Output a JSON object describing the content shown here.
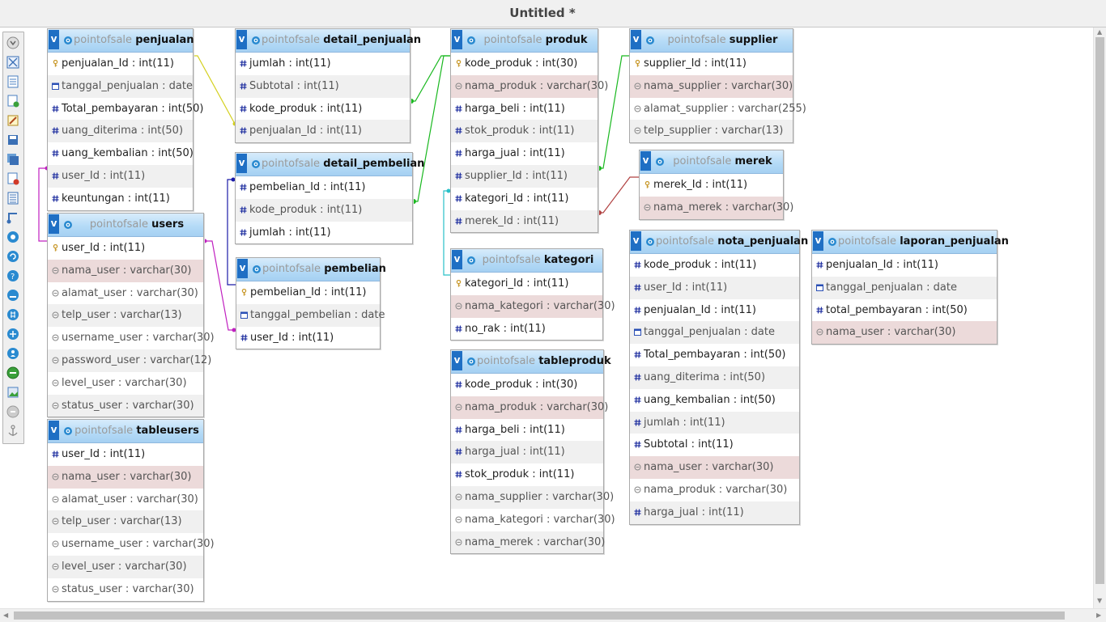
{
  "window": {
    "title": "Untitled *"
  },
  "toolbar": {
    "icons": [
      "toggle-icon",
      "fit-icon",
      "table-icon",
      "add-table-icon",
      "edit-icon",
      "save-icon",
      "save-all-icon",
      "delete-icon",
      "list-icon",
      "relation-icon",
      "zoom-icon",
      "refresh-icon",
      "help-icon",
      "angle-icon",
      "grid-icon",
      "move-icon",
      "export-icon",
      "pdf-icon",
      "image-icon",
      "info-icon",
      "anchor-icon"
    ]
  },
  "colors": {
    "header_blue": "#1f6fc4",
    "field_dark_blue": "#1f2fa0",
    "key_gold": "#c99a2e",
    "highlight_row": "#f2dcdc",
    "relation_yellow": "#d4d020",
    "relation_green": "#19b81f",
    "relation_purple": "#c020c0",
    "relation_navy": "#1a1aa8",
    "relation_cyan": "#28c0c8",
    "relation_red": "#b04040"
  },
  "tables": [
    {
      "id": "t-penjualan",
      "db": "pointofsale",
      "name": "penjualan",
      "fields": [
        {
          "text": "penjualan_Id : int(11)",
          "icon": "key"
        },
        {
          "text": "tanggal_penjualan : date",
          "icon": "date"
        },
        {
          "text": "Total_pembayaran : int(50)",
          "icon": "hash"
        },
        {
          "text": "uang_diterima : int(50)",
          "icon": "hash"
        },
        {
          "text": "uang_kembalian : int(50)",
          "icon": "hash"
        },
        {
          "text": "user_Id : int(11)",
          "icon": "hash"
        },
        {
          "text": "keuntungan : int(11)",
          "icon": "hash"
        }
      ]
    },
    {
      "id": "t-users",
      "db": "pointofsale",
      "name": "users",
      "fields": [
        {
          "text": "user_Id : int(11)",
          "icon": "key"
        },
        {
          "text": "nama_user : varchar(30)",
          "icon": "str",
          "hl": true
        },
        {
          "text": "alamat_user : varchar(30)",
          "icon": "str"
        },
        {
          "text": "telp_user : varchar(13)",
          "icon": "str"
        },
        {
          "text": "username_user : varchar(30)",
          "icon": "str"
        },
        {
          "text": "password_user : varchar(12)",
          "icon": "str"
        },
        {
          "text": "level_user : varchar(30)",
          "icon": "str"
        },
        {
          "text": "status_user : varchar(30)",
          "icon": "str"
        }
      ]
    },
    {
      "id": "t-tableusers",
      "db": "pointofsale",
      "name": "tableusers",
      "fields": [
        {
          "text": "user_Id : int(11)",
          "icon": "hash"
        },
        {
          "text": "nama_user : varchar(30)",
          "icon": "str",
          "hl": true
        },
        {
          "text": "alamat_user : varchar(30)",
          "icon": "str"
        },
        {
          "text": "telp_user : varchar(13)",
          "icon": "str"
        },
        {
          "text": "username_user : varchar(30)",
          "icon": "str"
        },
        {
          "text": "level_user : varchar(30)",
          "icon": "str"
        },
        {
          "text": "status_user : varchar(30)",
          "icon": "str"
        }
      ]
    },
    {
      "id": "t-detail_penjualan",
      "db": "pointofsale",
      "name": "detail_penjualan",
      "fields": [
        {
          "text": "jumlah : int(11)",
          "icon": "hash"
        },
        {
          "text": "Subtotal : int(11)",
          "icon": "hash"
        },
        {
          "text": "kode_produk : int(11)",
          "icon": "hash"
        },
        {
          "text": "penjualan_Id : int(11)",
          "icon": "hash"
        }
      ]
    },
    {
      "id": "t-detail_pembelian",
      "db": "pointofsale",
      "name": "detail_pembelian",
      "fields": [
        {
          "text": "pembelian_Id : int(11)",
          "icon": "hash"
        },
        {
          "text": "kode_produk : int(11)",
          "icon": "hash"
        },
        {
          "text": "jumlah : int(11)",
          "icon": "hash"
        }
      ]
    },
    {
      "id": "t-pembelian",
      "db": "pointofsale",
      "name": "pembelian",
      "fields": [
        {
          "text": "pembelian_Id : int(11)",
          "icon": "key"
        },
        {
          "text": "tanggal_pembelian : date",
          "icon": "date"
        },
        {
          "text": "user_Id : int(11)",
          "icon": "hash"
        }
      ]
    },
    {
      "id": "t-produk",
      "db": "pointofsale",
      "name": "produk",
      "fields": [
        {
          "text": "kode_produk : int(30)",
          "icon": "key"
        },
        {
          "text": "nama_produk : varchar(30)",
          "icon": "str",
          "hl": true
        },
        {
          "text": "harga_beli : int(11)",
          "icon": "hash"
        },
        {
          "text": "stok_produk : int(11)",
          "icon": "hash"
        },
        {
          "text": "harga_jual : int(11)",
          "icon": "hash"
        },
        {
          "text": "supplier_Id : int(11)",
          "icon": "hash"
        },
        {
          "text": "kategori_Id : int(11)",
          "icon": "hash"
        },
        {
          "text": "merek_Id : int(11)",
          "icon": "hash"
        }
      ]
    },
    {
      "id": "t-kategori",
      "db": "pointofsale",
      "name": "kategori",
      "fields": [
        {
          "text": "kategori_Id : int(11)",
          "icon": "key"
        },
        {
          "text": "nama_kategori : varchar(30)",
          "icon": "str",
          "hl": true
        },
        {
          "text": "no_rak : int(11)",
          "icon": "hash"
        }
      ]
    },
    {
      "id": "t-tableproduk",
      "db": "pointofsale",
      "name": "tableproduk",
      "fields": [
        {
          "text": "kode_produk : int(30)",
          "icon": "hash"
        },
        {
          "text": "nama_produk : varchar(30)",
          "icon": "str",
          "hl": true
        },
        {
          "text": "harga_beli : int(11)",
          "icon": "hash"
        },
        {
          "text": "harga_jual : int(11)",
          "icon": "hash"
        },
        {
          "text": "stok_produk : int(11)",
          "icon": "hash"
        },
        {
          "text": "nama_supplier : varchar(30)",
          "icon": "str"
        },
        {
          "text": "nama_kategori : varchar(30)",
          "icon": "str"
        },
        {
          "text": "nama_merek : varchar(30)",
          "icon": "str"
        }
      ]
    },
    {
      "id": "t-supplier",
      "db": "pointofsale",
      "name": "supplier",
      "fields": [
        {
          "text": "supplier_Id : int(11)",
          "icon": "key"
        },
        {
          "text": "nama_supplier : varchar(30)",
          "icon": "str",
          "hl": true
        },
        {
          "text": "alamat_supplier : varchar(255)",
          "icon": "str"
        },
        {
          "text": "telp_supplier : varchar(13)",
          "icon": "str"
        }
      ]
    },
    {
      "id": "t-merek",
      "db": "pointofsale",
      "name": "merek",
      "fields": [
        {
          "text": "merek_Id : int(11)",
          "icon": "key"
        },
        {
          "text": "nama_merek : varchar(30)",
          "icon": "str",
          "hl": true
        }
      ]
    },
    {
      "id": "t-nota_penjualan",
      "db": "pointofsale",
      "name": "nota_penjualan",
      "fields": [
        {
          "text": "kode_produk : int(11)",
          "icon": "hash"
        },
        {
          "text": "user_Id : int(11)",
          "icon": "hash"
        },
        {
          "text": "penjualan_Id : int(11)",
          "icon": "hash"
        },
        {
          "text": "tanggal_penjualan : date",
          "icon": "date"
        },
        {
          "text": "Total_pembayaran : int(50)",
          "icon": "hash"
        },
        {
          "text": "uang_diterima : int(50)",
          "icon": "hash"
        },
        {
          "text": "uang_kembalian : int(50)",
          "icon": "hash"
        },
        {
          "text": "jumlah : int(11)",
          "icon": "hash"
        },
        {
          "text": "Subtotal : int(11)",
          "icon": "hash"
        },
        {
          "text": "nama_user : varchar(30)",
          "icon": "str",
          "hl": true
        },
        {
          "text": "nama_produk : varchar(30)",
          "icon": "str"
        },
        {
          "text": "harga_jual : int(11)",
          "icon": "hash"
        }
      ]
    },
    {
      "id": "t-laporan_penjualan",
      "db": "pointofsale",
      "name": "laporan_penjualan",
      "fields": [
        {
          "text": "penjualan_Id : int(11)",
          "icon": "hash"
        },
        {
          "text": "tanggal_penjualan : date",
          "icon": "date"
        },
        {
          "text": "total_pembayaran : int(50)",
          "icon": "hash"
        },
        {
          "text": "nama_user : varchar(30)",
          "icon": "str",
          "hl": true
        }
      ]
    }
  ]
}
